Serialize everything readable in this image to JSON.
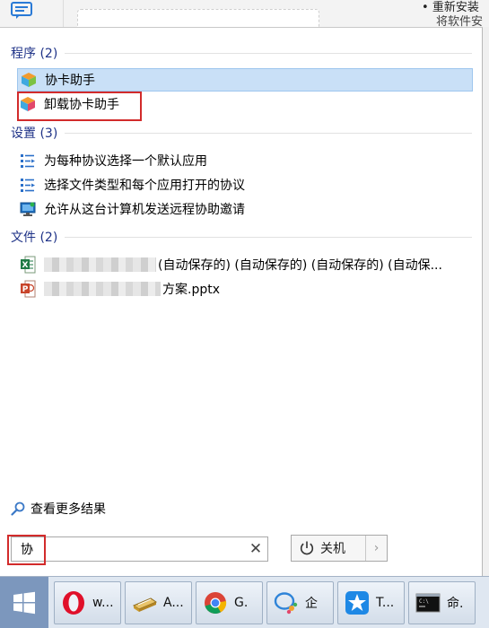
{
  "background": {
    "line1": "重新安装",
    "line2": "将软件安"
  },
  "sections": {
    "programs": {
      "header": "程序 (2)",
      "items": [
        {
          "label": "协卡助手",
          "icon": "app-cube-icon",
          "selected": true
        },
        {
          "label": "卸载协卡助手",
          "icon": "uninstall-cube-icon",
          "highlighted": true
        }
      ]
    },
    "settings": {
      "header": "设置 (3)",
      "items": [
        {
          "label": "为每种协议选择一个默认应用",
          "icon": "list-settings-icon"
        },
        {
          "label": "选择文件类型和每个应用打开的协议",
          "icon": "list-settings-icon"
        },
        {
          "label": "允许从这台计算机发送远程协助邀请",
          "icon": "remote-monitor-icon"
        }
      ]
    },
    "files": {
      "header": "文件 (2)",
      "items": [
        {
          "label": "(自动保存的) (自动保存的) (自动保存的) (自动保...",
          "icon": "excel-file-icon"
        },
        {
          "label": "方案.pptx",
          "icon": "powerpoint-file-icon"
        }
      ]
    }
  },
  "more_results": "查看更多结果",
  "search": {
    "value": "协",
    "clear_symbol": "✕"
  },
  "shutdown": {
    "label": "关机",
    "arrow": "›"
  },
  "taskbar": {
    "items": [
      {
        "label": "w...",
        "icon": "opera-icon"
      },
      {
        "label": "A...",
        "icon": "scanner-icon"
      },
      {
        "label": "G.",
        "icon": "chrome-icon"
      },
      {
        "label": "企",
        "icon": "wecom-icon"
      },
      {
        "label": "T...",
        "icon": "star-app-icon"
      },
      {
        "label": "命.",
        "icon": "console-icon"
      }
    ]
  },
  "colors": {
    "section_header": "#1e3287",
    "selection_bg": "#c9e0f7",
    "highlight_box": "#d22b2b",
    "taskbar_bg": "#dfe7f1"
  }
}
